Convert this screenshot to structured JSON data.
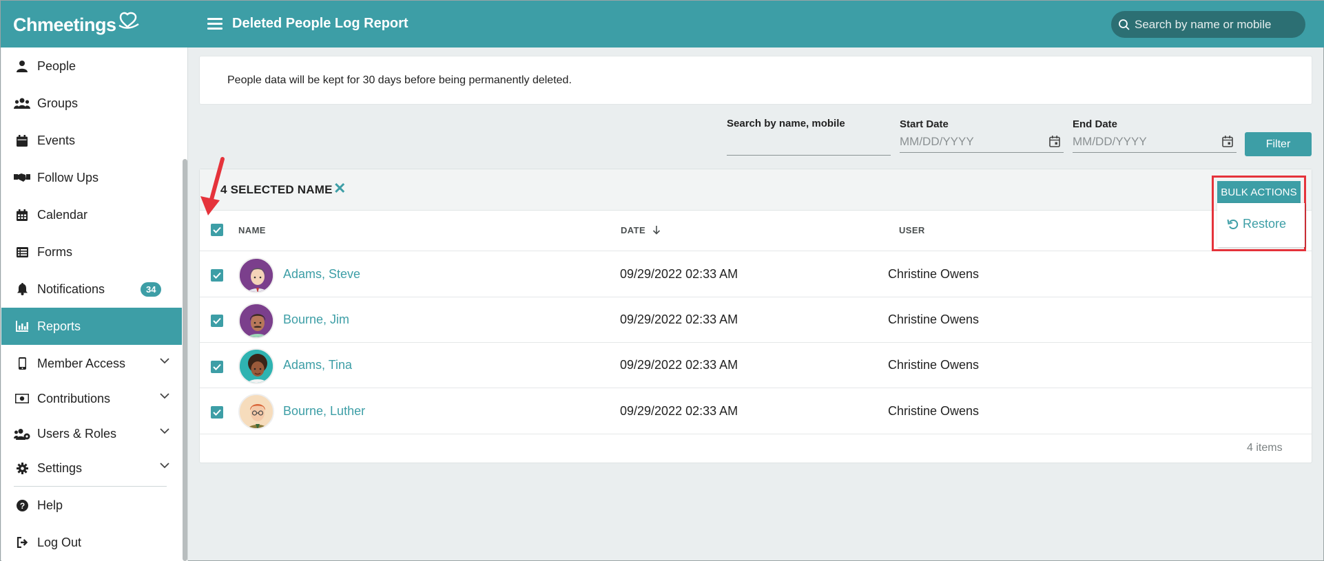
{
  "app": {
    "brand": "Chmeetings",
    "page_title": "Deleted People Log Report"
  },
  "header": {
    "search_placeholder": "Search by name or mobile"
  },
  "sidebar": {
    "items": [
      {
        "label": "People",
        "icon": "person-icon"
      },
      {
        "label": "Groups",
        "icon": "groups-icon"
      },
      {
        "label": "Events",
        "icon": "calendar-icon"
      },
      {
        "label": "Follow Ups",
        "icon": "handshake-icon"
      },
      {
        "label": "Calendar",
        "icon": "calendar-grid-icon"
      },
      {
        "label": "Forms",
        "icon": "list-icon"
      },
      {
        "label": "Notifications",
        "icon": "bell-icon",
        "badge": "34"
      },
      {
        "label": "Reports",
        "icon": "bar-chart-icon",
        "active": true
      },
      {
        "label": "Member Access",
        "icon": "mobile-icon",
        "expandable": true
      },
      {
        "label": "Contributions",
        "icon": "money-icon",
        "expandable": true
      },
      {
        "label": "Users & Roles",
        "icon": "users-roles-icon",
        "expandable": true
      },
      {
        "label": "Settings",
        "icon": "gear-icon",
        "expandable": true
      },
      {
        "label": "Help",
        "icon": "help-icon"
      },
      {
        "label": "Log Out",
        "icon": "logout-icon"
      }
    ]
  },
  "notice": {
    "text": "People data will be kept for 30 days before being permanently deleted."
  },
  "filters": {
    "search_label": "Search by name, mobile",
    "start_label": "Start Date",
    "start_placeholder": "MM/DD/YYYY",
    "end_label": "End Date",
    "end_placeholder": "MM/DD/YYYY",
    "filter_button": "Filter"
  },
  "selection": {
    "text": "4 SELECTED NAME",
    "clear": "✕"
  },
  "bulk_actions": {
    "label": "BULK ACTIONS",
    "restore": "Restore"
  },
  "table": {
    "columns": {
      "name": "NAME",
      "date": "DATE",
      "user": "USER"
    },
    "rows": [
      {
        "name": "Adams, Steve",
        "date": "09/29/2022 02:33 AM",
        "user": "Christine Owens",
        "checked": true
      },
      {
        "name": "Bourne, Jim",
        "date": "09/29/2022 02:33 AM",
        "user": "Christine Owens",
        "checked": true
      },
      {
        "name": "Adams, Tina",
        "date": "09/29/2022 02:33 AM",
        "user": "Christine Owens",
        "checked": true
      },
      {
        "name": "Bourne, Luther",
        "date": "09/29/2022 02:33 AM",
        "user": "Christine Owens",
        "checked": true
      }
    ],
    "footer": "4 items"
  },
  "colors": {
    "accent": "#3d9ea6",
    "highlight": "#e5333b",
    "background": "#eaeeef"
  }
}
